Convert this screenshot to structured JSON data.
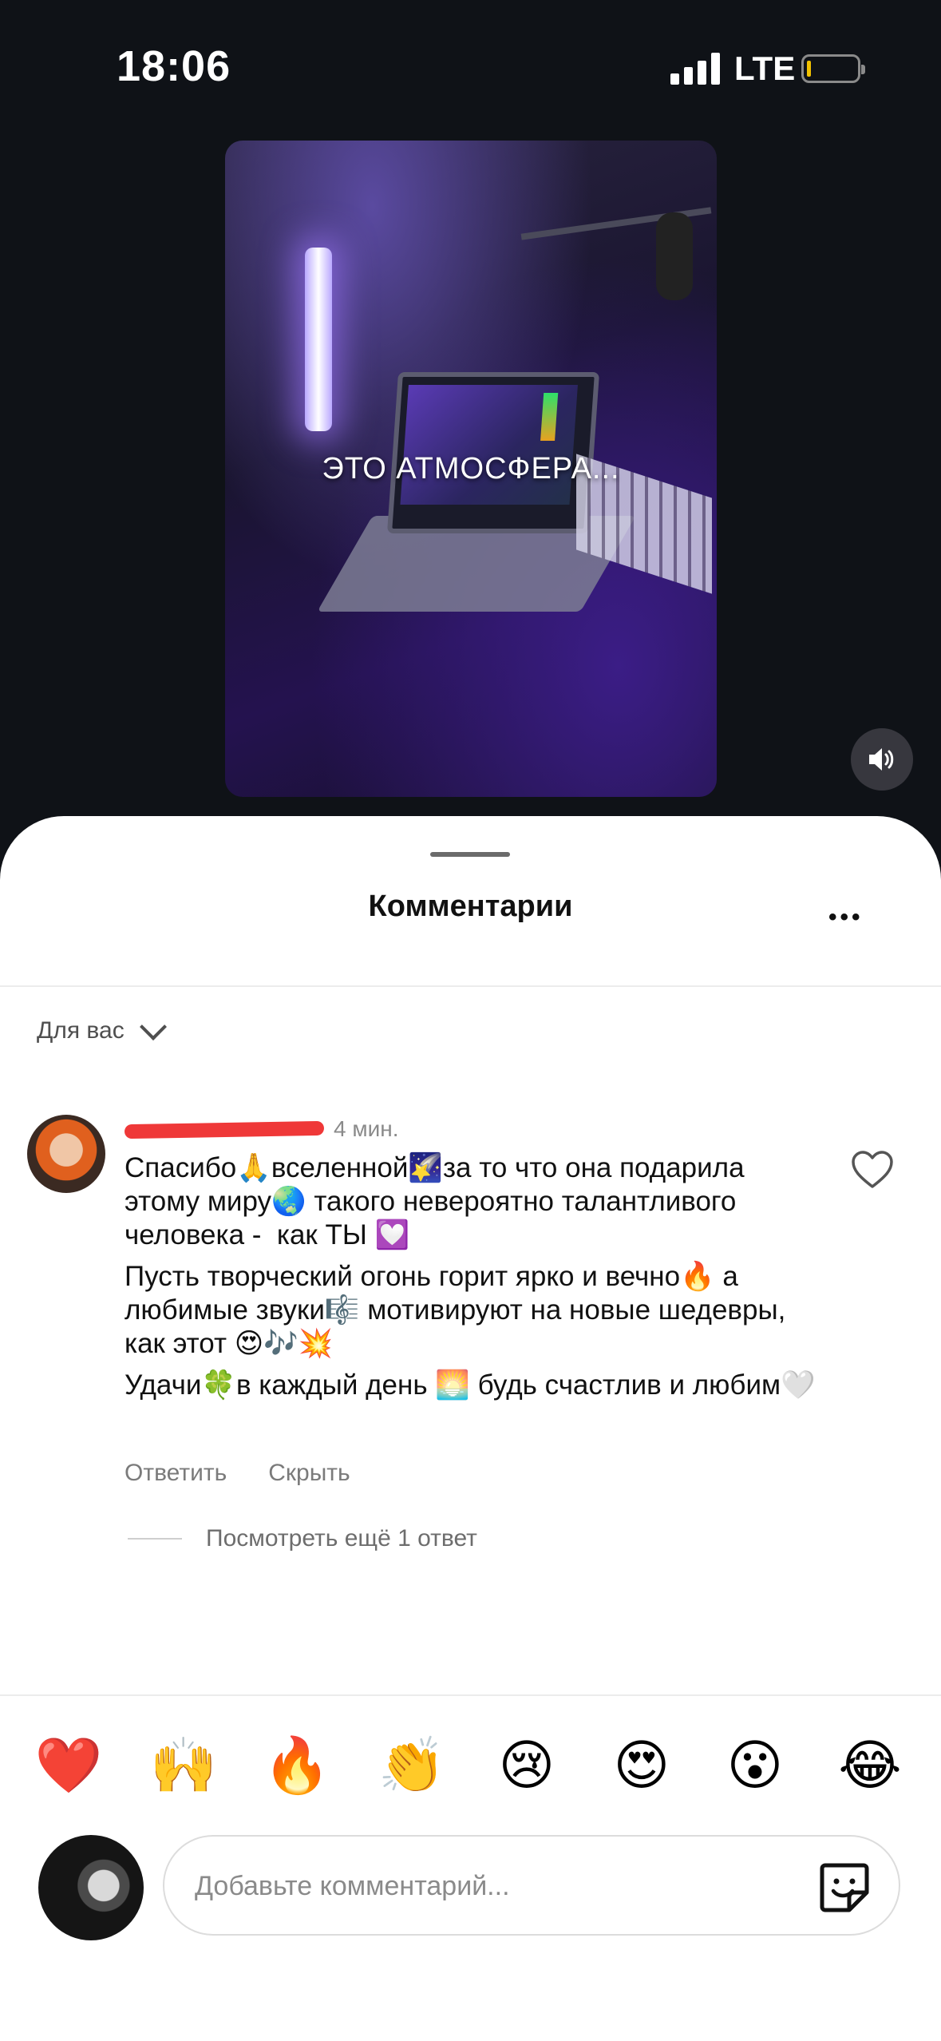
{
  "status_bar": {
    "time": "18:06",
    "network": "LTE",
    "battery_icon": "battery-low-icon",
    "signal_icon": "signal-bars-icon"
  },
  "video": {
    "caption": "ЭТО АТМОСФЕРА...",
    "sound_icon": "speaker-icon"
  },
  "sheet": {
    "title": "Комментарии",
    "more_icon": "more-dots-icon"
  },
  "filter": {
    "label": "Для вас",
    "chevron_icon": "chevron-down-icon"
  },
  "comment": {
    "time": "4 мин.",
    "lines": [
      "Спасибо🙏вселенной🌠за то что она подарила этому миру🌏 такого невероятно талантливого человека -  как ТЫ 💟",
      "Пусть творческий огонь горит ярко и вечно🔥 а любимые звуки🎼 мотивируют на новые шедевры, как этот 😍🎶💥",
      "Удачи🍀в каждый день 🌅 будь счастлив и любим🤍"
    ],
    "reply_label": "Ответить",
    "hide_label": "Скрыть",
    "view_more_label": "Посмотреть ещё 1 ответ",
    "like_icon": "heart-outline-icon"
  },
  "quick_reactions": [
    "❤️",
    "🙌",
    "🔥",
    "👏",
    "😢",
    "😍",
    "😮",
    "😂"
  ],
  "composer": {
    "placeholder": "Добавьте комментарий...",
    "sticker_icon": "sticker-icon"
  }
}
